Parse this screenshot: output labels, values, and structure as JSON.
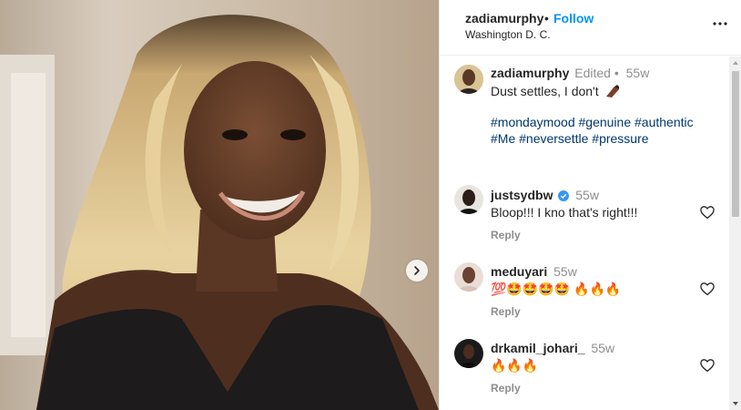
{
  "header": {
    "username": "zadiamurphy",
    "dot": "•",
    "follow_label": "Follow",
    "location": "Washington D. C."
  },
  "caption": {
    "username": "zadiamurphy",
    "edited": "Edited",
    "dot": "•",
    "time": "55w",
    "text": "Dust settles, I don't",
    "hashtags_line1": "#mondaymood #genuine #authentic",
    "hashtags_line2": "#Me #neversettle #pressure"
  },
  "comments": [
    {
      "username": "justsydbw",
      "time": "55w",
      "text": "Bloop!!! I kno that's right!!!",
      "reply_label": "Reply",
      "verified": true
    },
    {
      "username": "meduyari",
      "time": "55w",
      "text": "💯🤩🤩🤩🤩 🔥🔥🔥",
      "reply_label": "Reply",
      "verified": false
    },
    {
      "username": "drkamil_johari_",
      "time": "55w",
      "text": "🔥🔥🔥",
      "reply_label": "Reply",
      "verified": false
    }
  ],
  "icons": {
    "more": "more-options-icon",
    "next": "chevron-right-icon",
    "heart": "heart-outline-icon",
    "verified": "verified-badge-icon",
    "settle_emoji": "nail-polish-emoji"
  },
  "colors": {
    "follow_blue": "#0095f6",
    "hashtag_blue": "#00376b",
    "verified_blue": "#3897f0",
    "muted_gray": "#8e8e8e"
  }
}
